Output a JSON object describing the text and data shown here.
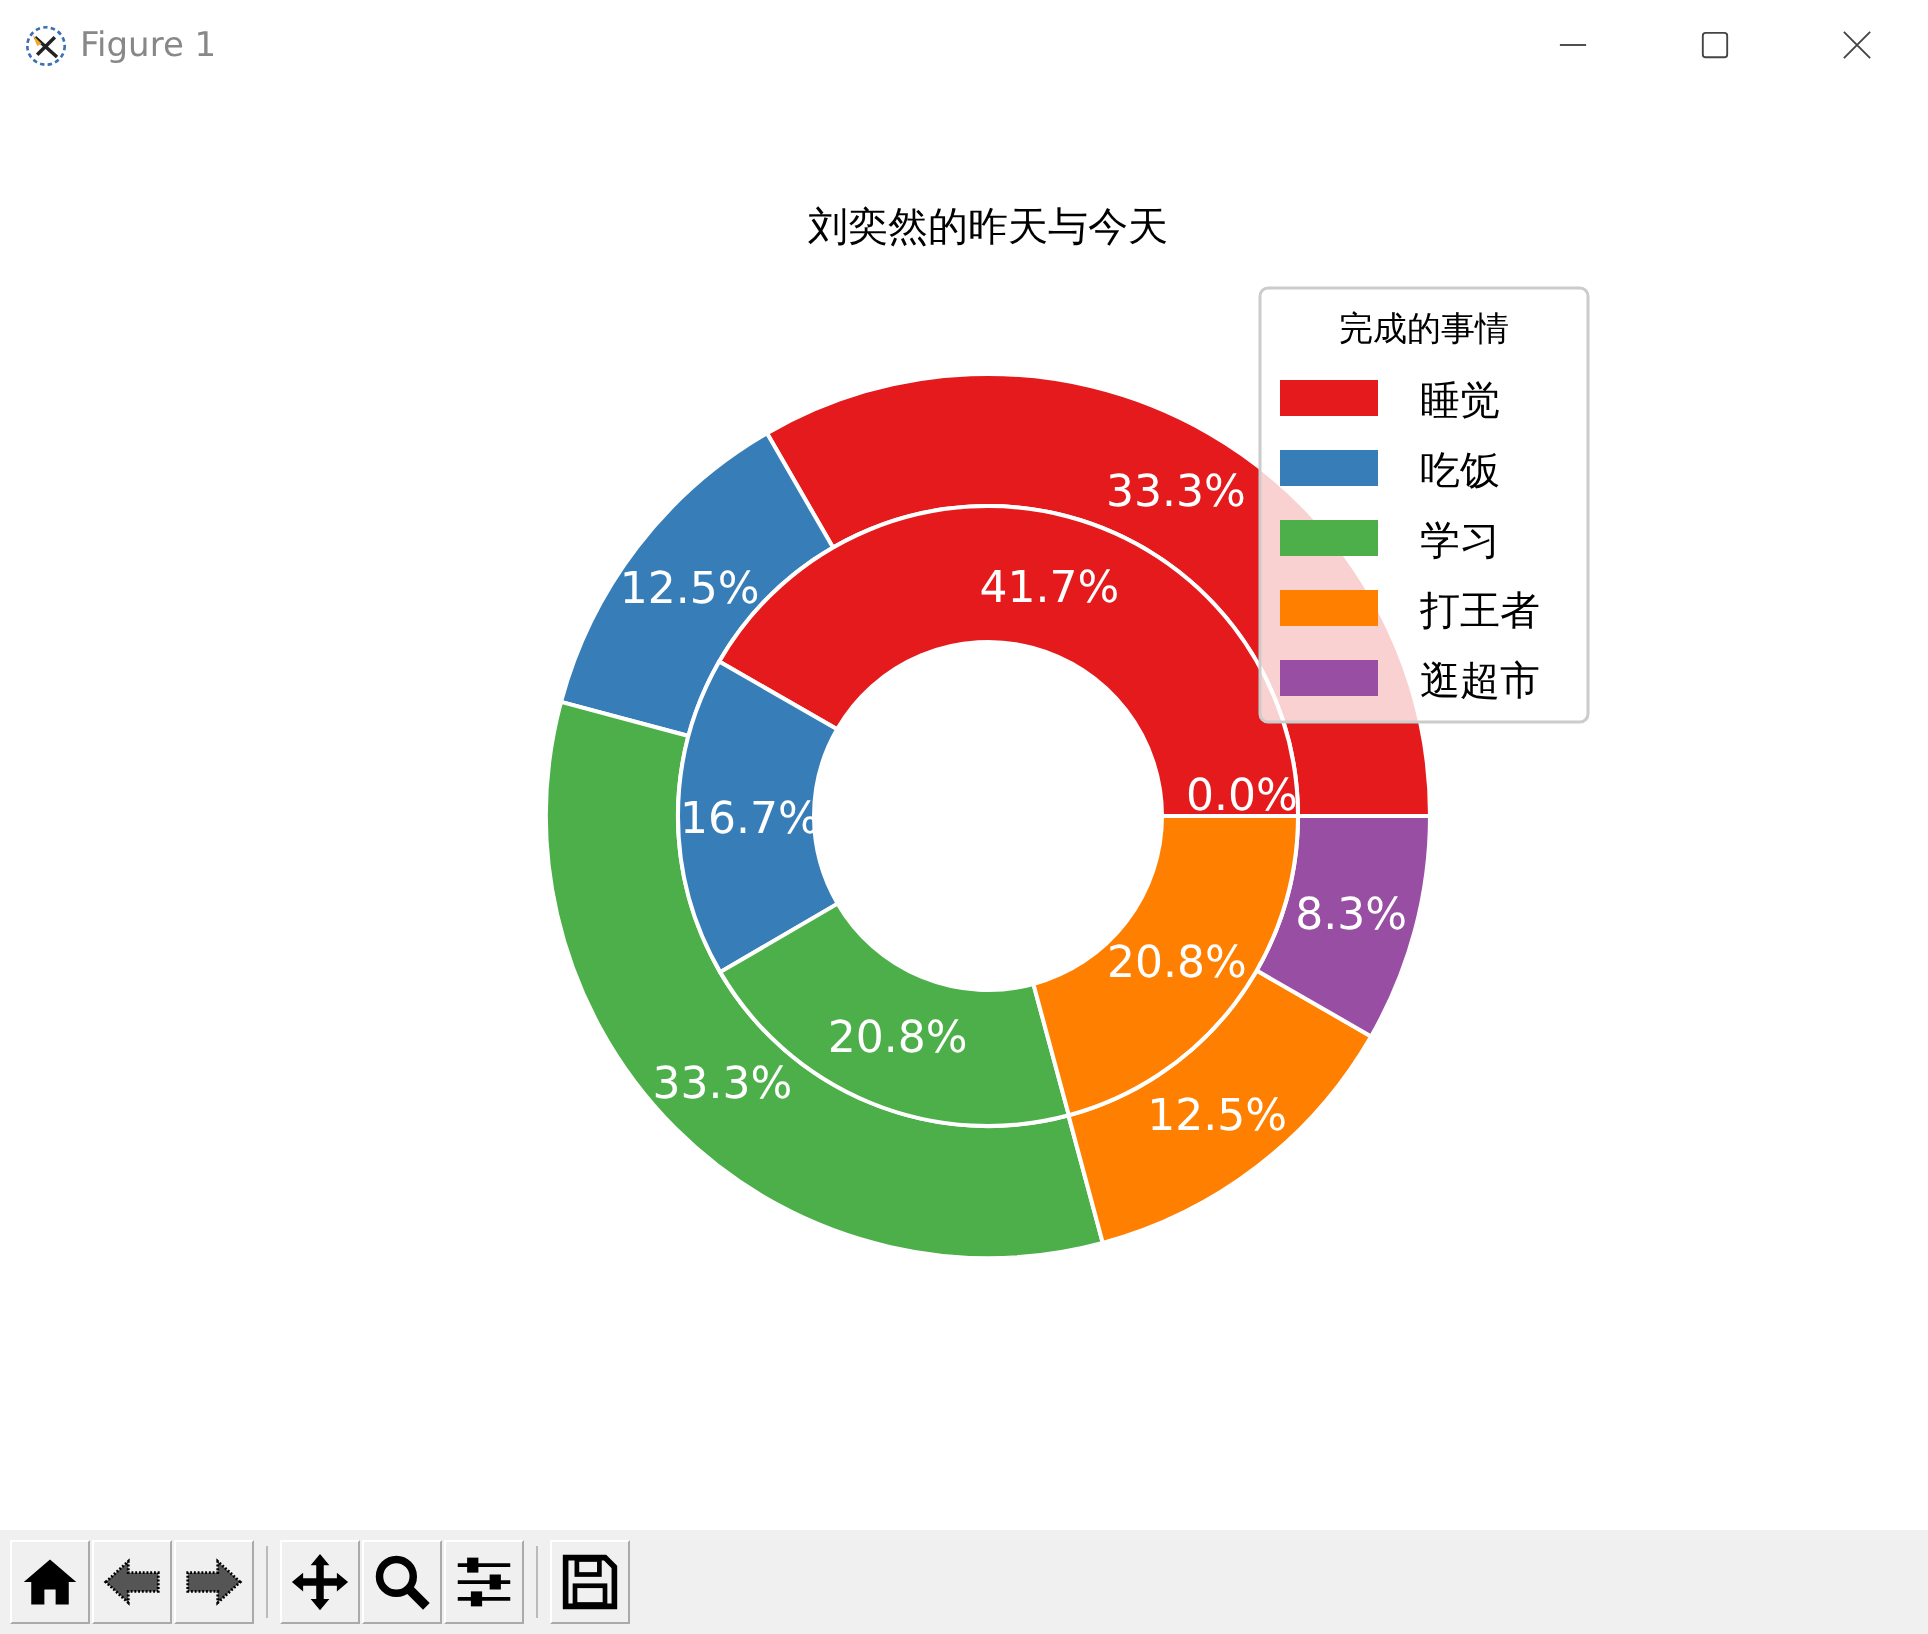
{
  "window": {
    "title": "Figure 1"
  },
  "chart": {
    "chart_data": {
      "type": "donut",
      "title": "刘奕然的昨天与今天",
      "categories": [
        "睡觉",
        "吃饭",
        "学习",
        "打王者",
        "逛超市"
      ],
      "colors": [
        "#e41a1c",
        "#377eb8",
        "#4daf4a",
        "#ff7f00",
        "#984ea3"
      ],
      "series": [
        {
          "values": [
            33.3,
            12.5,
            33.3,
            12.5,
            8.3
          ],
          "value_labels": [
            "33.3%",
            "12.5%",
            "33.3%",
            "12.5%",
            "8.3%"
          ]
        },
        {
          "values": [
            41.7,
            16.7,
            20.8,
            20.8,
            0.0
          ],
          "value_labels": [
            "41.7%",
            "16.7%",
            "20.8%",
            "20.8%",
            "0.0%"
          ]
        }
      ],
      "legend": {
        "title": "完成的事情"
      }
    }
  }
}
